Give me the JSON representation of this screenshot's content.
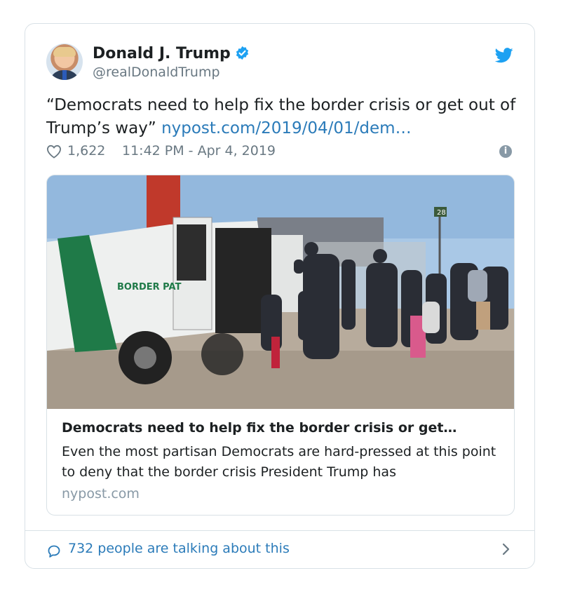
{
  "author": {
    "name": "Donald J. Trump",
    "handle": "@realDonaldTrump"
  },
  "tweet": {
    "text": "“Democrats need to help fix the border crisis or get out of Trump’s way”",
    "link": "nypost.com/2019/04/01/dem…"
  },
  "meta": {
    "likes": "1,622",
    "timestamp": "11:42 PM - Apr 4, 2019"
  },
  "preview": {
    "image_sign_text": "BORDER PAT",
    "image_post_number": "28",
    "title": "Democrats need to help fix the border crisis or get…",
    "description": "Even the most partisan Democrats are hard-pressed at this point to deny that the border crisis President Trump has",
    "domain": "nypost.com"
  },
  "footer": {
    "talking": "732 people are talking about this"
  },
  "colors": {
    "link": "#2b7bb9",
    "verified": "#1da1f2",
    "muted": "#697882",
    "border": "#d9e1e6"
  },
  "icons": [
    "verified-badge-icon",
    "twitter-bird-icon",
    "heart-icon",
    "info-icon",
    "speech-bubble-icon",
    "chevron-right-icon"
  ]
}
